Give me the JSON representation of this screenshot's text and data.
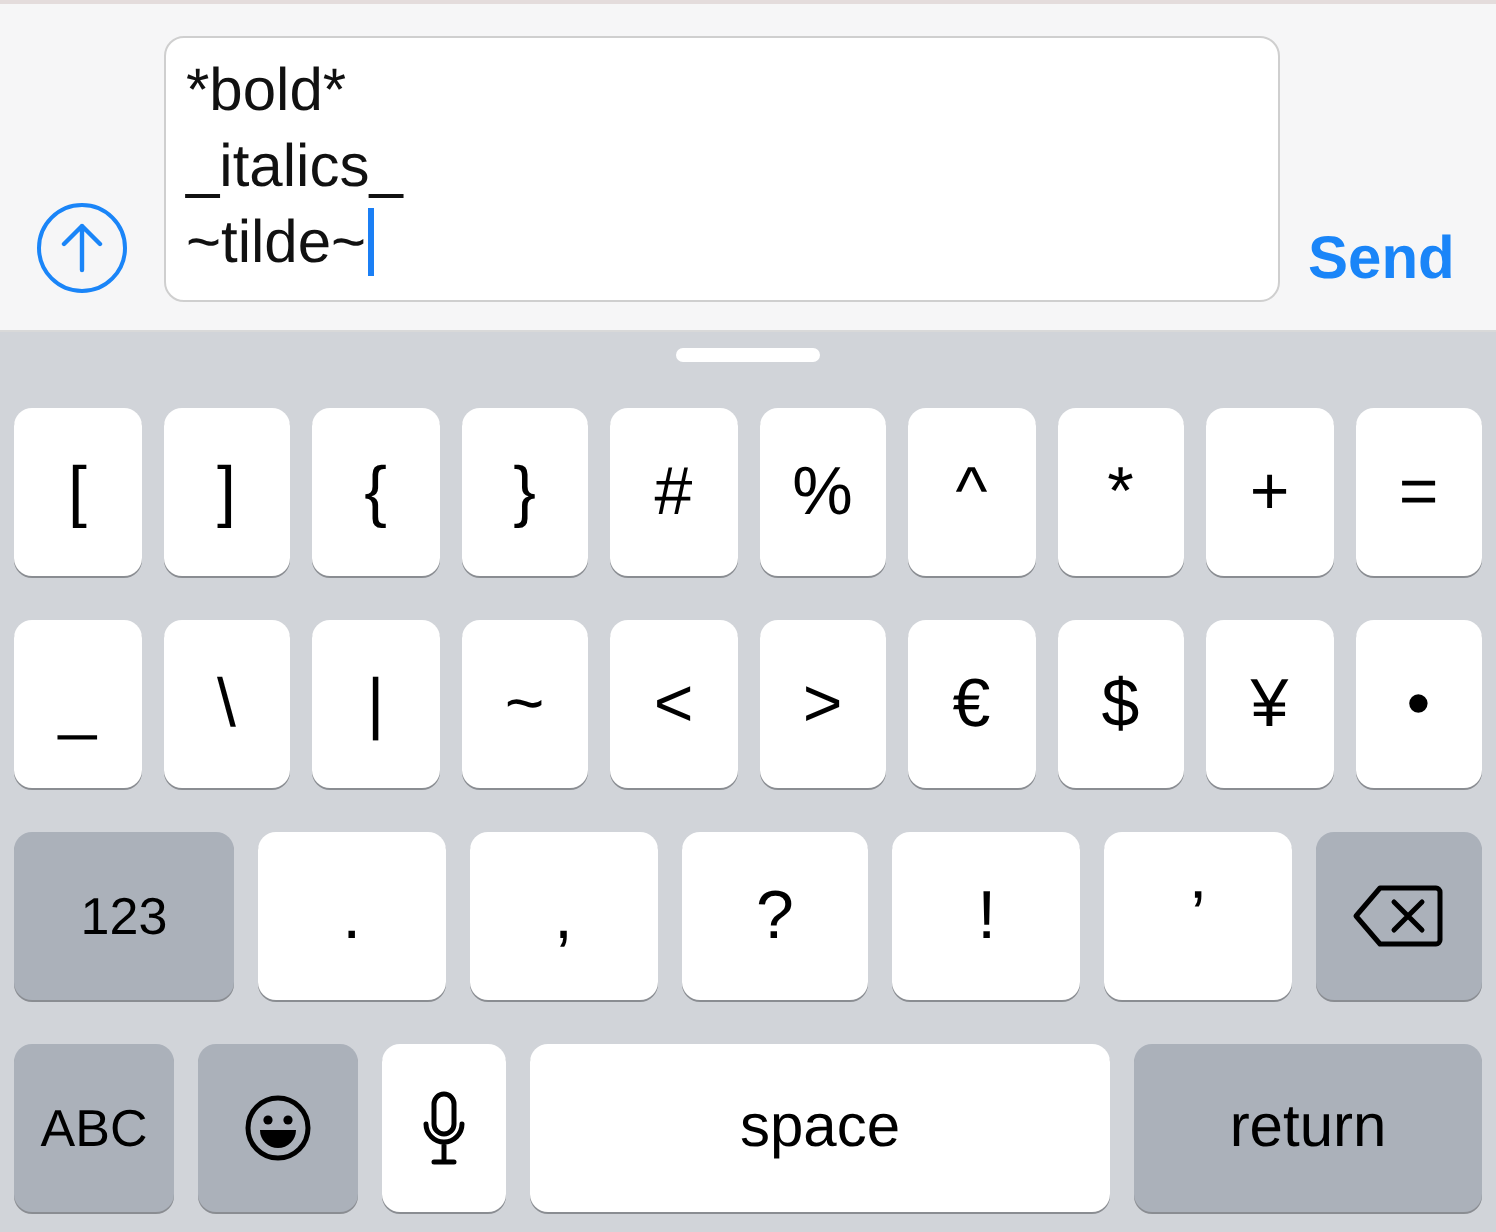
{
  "composer": {
    "value": "*bold*\n_italics_\n~tilde~",
    "send": "Send"
  },
  "keyboard": {
    "rows": [
      {
        "keys": [
          {
            "kind": "char",
            "label": "["
          },
          {
            "kind": "char",
            "label": "]"
          },
          {
            "kind": "char",
            "label": "{"
          },
          {
            "kind": "char",
            "label": "}"
          },
          {
            "kind": "char",
            "label": "#"
          },
          {
            "kind": "char",
            "label": "%"
          },
          {
            "kind": "char",
            "label": "^"
          },
          {
            "kind": "char",
            "label": "*"
          },
          {
            "kind": "char",
            "label": "+"
          },
          {
            "kind": "char",
            "label": "="
          }
        ]
      },
      {
        "keys": [
          {
            "kind": "char",
            "label": "_"
          },
          {
            "kind": "char",
            "label": "\\"
          },
          {
            "kind": "char",
            "label": "|"
          },
          {
            "kind": "char",
            "label": "~"
          },
          {
            "kind": "char",
            "label": "<"
          },
          {
            "kind": "char",
            "label": ">"
          },
          {
            "kind": "char",
            "label": "€"
          },
          {
            "kind": "char",
            "label": "$"
          },
          {
            "kind": "char",
            "label": "¥"
          },
          {
            "kind": "char",
            "label": "•"
          }
        ]
      },
      {
        "keys": [
          {
            "kind": "mode",
            "label": "123"
          },
          {
            "kind": "char",
            "label": "."
          },
          {
            "kind": "char",
            "label": ","
          },
          {
            "kind": "char",
            "label": "?"
          },
          {
            "kind": "char",
            "label": "!"
          },
          {
            "kind": "char",
            "label": "’"
          },
          {
            "kind": "backspace"
          }
        ]
      },
      {
        "keys": [
          {
            "kind": "abc",
            "label": "ABC"
          },
          {
            "kind": "emoji"
          },
          {
            "kind": "mic"
          },
          {
            "kind": "space",
            "label": "space"
          },
          {
            "kind": "return",
            "label": "return"
          }
        ]
      }
    ]
  }
}
